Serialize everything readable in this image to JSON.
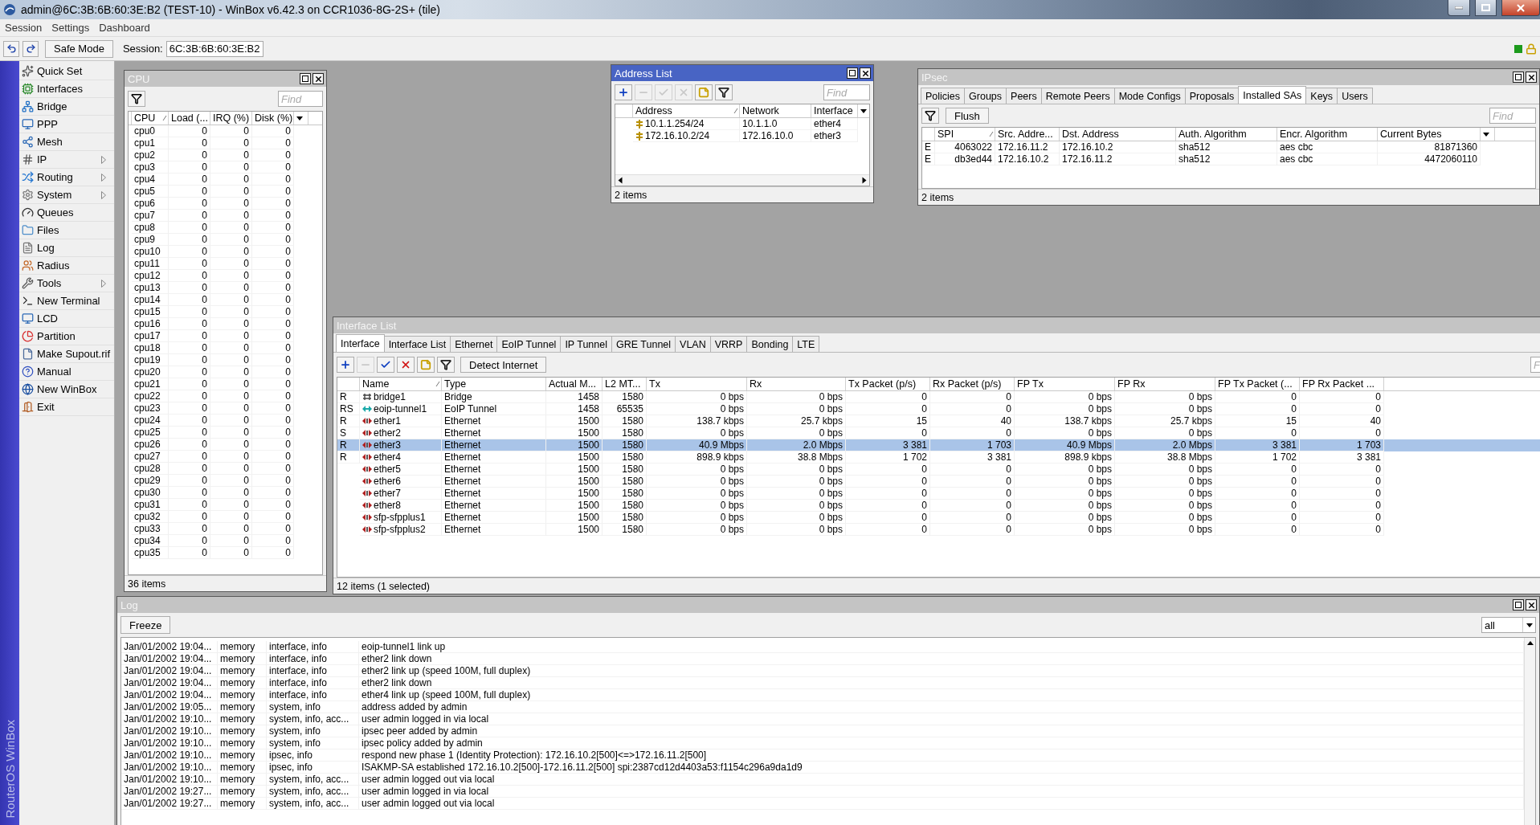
{
  "app_title": "admin@6C:3B:6B:60:3E:B2 (TEST-10) - WinBox v6.42.3 on CCR1036-8G-2S+ (tile)",
  "menu": [
    "Session",
    "Settings",
    "Dashboard"
  ],
  "toolbar": {
    "safe_mode": "Safe Mode",
    "session_label": "Session:",
    "session_value": "6C:3B:6B:60:3E:B2"
  },
  "side_strip": "RouterOS WinBox",
  "sidebar": [
    {
      "label": "Quick Set",
      "submenu": false
    },
    {
      "label": "Interfaces",
      "submenu": false
    },
    {
      "label": "Bridge",
      "submenu": false
    },
    {
      "label": "PPP",
      "submenu": false
    },
    {
      "label": "Mesh",
      "submenu": false
    },
    {
      "label": "IP",
      "submenu": true
    },
    {
      "label": "Routing",
      "submenu": true
    },
    {
      "label": "System",
      "submenu": true
    },
    {
      "label": "Queues",
      "submenu": false
    },
    {
      "label": "Files",
      "submenu": false
    },
    {
      "label": "Log",
      "submenu": false
    },
    {
      "label": "Radius",
      "submenu": false
    },
    {
      "label": "Tools",
      "submenu": true
    },
    {
      "label": "New Terminal",
      "submenu": false
    },
    {
      "label": "LCD",
      "submenu": false
    },
    {
      "label": "Partition",
      "submenu": false
    },
    {
      "label": "Make Supout.rif",
      "submenu": false
    },
    {
      "label": "Manual",
      "submenu": false
    },
    {
      "label": "New WinBox",
      "submenu": false
    },
    {
      "label": "Exit",
      "submenu": false
    }
  ],
  "cpu_window": {
    "title": "CPU",
    "active": false,
    "find_placeholder": "Find",
    "columns": [
      {
        "label": "CPU",
        "sorted": true
      },
      {
        "label": "Load (...",
        "sorted": false
      },
      {
        "label": "IRQ (%)",
        "sorted": false
      },
      {
        "label": "Disk (%)",
        "sorted": false
      }
    ],
    "rows": [
      [
        "cpu0",
        "0",
        "0",
        "0"
      ],
      [
        "cpu1",
        "0",
        "0",
        "0"
      ],
      [
        "cpu2",
        "0",
        "0",
        "0"
      ],
      [
        "cpu3",
        "0",
        "0",
        "0"
      ],
      [
        "cpu4",
        "0",
        "0",
        "0"
      ],
      [
        "cpu5",
        "0",
        "0",
        "0"
      ],
      [
        "cpu6",
        "0",
        "0",
        "0"
      ],
      [
        "cpu7",
        "0",
        "0",
        "0"
      ],
      [
        "cpu8",
        "0",
        "0",
        "0"
      ],
      [
        "cpu9",
        "0",
        "0",
        "0"
      ],
      [
        "cpu10",
        "0",
        "0",
        "0"
      ],
      [
        "cpu11",
        "0",
        "0",
        "0"
      ],
      [
        "cpu12",
        "0",
        "0",
        "0"
      ],
      [
        "cpu13",
        "0",
        "0",
        "0"
      ],
      [
        "cpu14",
        "0",
        "0",
        "0"
      ],
      [
        "cpu15",
        "0",
        "0",
        "0"
      ],
      [
        "cpu16",
        "0",
        "0",
        "0"
      ],
      [
        "cpu17",
        "0",
        "0",
        "0"
      ],
      [
        "cpu18",
        "0",
        "0",
        "0"
      ],
      [
        "cpu19",
        "0",
        "0",
        "0"
      ],
      [
        "cpu20",
        "0",
        "0",
        "0"
      ],
      [
        "cpu21",
        "0",
        "0",
        "0"
      ],
      [
        "cpu22",
        "0",
        "0",
        "0"
      ],
      [
        "cpu23",
        "0",
        "0",
        "0"
      ],
      [
        "cpu24",
        "0",
        "0",
        "0"
      ],
      [
        "cpu25",
        "0",
        "0",
        "0"
      ],
      [
        "cpu26",
        "0",
        "0",
        "0"
      ],
      [
        "cpu27",
        "0",
        "0",
        "0"
      ],
      [
        "cpu28",
        "0",
        "0",
        "0"
      ],
      [
        "cpu29",
        "0",
        "0",
        "0"
      ],
      [
        "cpu30",
        "0",
        "0",
        "0"
      ],
      [
        "cpu31",
        "0",
        "0",
        "0"
      ],
      [
        "cpu32",
        "0",
        "0",
        "0"
      ],
      [
        "cpu33",
        "0",
        "0",
        "0"
      ],
      [
        "cpu34",
        "0",
        "0",
        "0"
      ],
      [
        "cpu35",
        "0",
        "0",
        "0"
      ]
    ],
    "status": "36 items"
  },
  "address_list": {
    "title": "Address List",
    "active": true,
    "find_placeholder": "Find",
    "toolbar": [
      {
        "kind": "add",
        "disabled": false
      },
      {
        "kind": "remove",
        "disabled": true
      },
      {
        "kind": "enable",
        "disabled": true
      },
      {
        "kind": "disable",
        "disabled": true
      },
      {
        "kind": "comment",
        "disabled": false
      },
      {
        "kind": "filter",
        "disabled": false
      }
    ],
    "columns": [
      {
        "label": "Address",
        "sorted": true
      },
      {
        "label": "Network",
        "sorted": false
      },
      {
        "label": "Interface",
        "sorted": false
      }
    ],
    "rows": [
      [
        "10.1.1.254/24",
        "10.1.1.0",
        "ether4"
      ],
      [
        "172.16.10.2/24",
        "172.16.10.0",
        "ether3"
      ]
    ],
    "status": "2 items"
  },
  "ipsec": {
    "title": "IPsec",
    "active": false,
    "tabs": [
      {
        "label": "Policies",
        "selected": false
      },
      {
        "label": "Groups",
        "selected": false
      },
      {
        "label": "Peers",
        "selected": false
      },
      {
        "label": "Remote Peers",
        "selected": false
      },
      {
        "label": "Mode Configs",
        "selected": false
      },
      {
        "label": "Proposals",
        "selected": false
      },
      {
        "label": "Installed SAs",
        "selected": true
      },
      {
        "label": "Keys",
        "selected": false
      },
      {
        "label": "Users",
        "selected": false
      }
    ],
    "flush": "Flush",
    "find_placeholder": "Find",
    "columns": [
      {
        "label": "SPI",
        "sorted": true
      },
      {
        "label": "Src. Addre...",
        "sorted": false
      },
      {
        "label": "Dst. Address",
        "sorted": false
      },
      {
        "label": "Auth. Algorithm",
        "sorted": false
      },
      {
        "label": "Encr. Algorithm",
        "sorted": false
      },
      {
        "label": "Current Bytes",
        "sorted": false
      }
    ],
    "rows": [
      {
        "flag": "E",
        "cells": [
          "4063022",
          "172.16.11.2",
          "172.16.10.2",
          "sha512",
          "aes cbc",
          "81871360"
        ]
      },
      {
        "flag": "E",
        "cells": [
          "db3ed44",
          "172.16.10.2",
          "172.16.11.2",
          "sha512",
          "aes cbc",
          "4472060110"
        ]
      }
    ],
    "status": "2 items"
  },
  "interface_list": {
    "title": "Interface List",
    "active": false,
    "tabs": [
      {
        "label": "Interface",
        "selected": true
      },
      {
        "label": "Interface List",
        "selected": false
      },
      {
        "label": "Ethernet",
        "selected": false
      },
      {
        "label": "EoIP Tunnel",
        "selected": false
      },
      {
        "label": "IP Tunnel",
        "selected": false
      },
      {
        "label": "GRE Tunnel",
        "selected": false
      },
      {
        "label": "VLAN",
        "selected": false
      },
      {
        "label": "VRRP",
        "selected": false
      },
      {
        "label": "Bonding",
        "selected": false
      },
      {
        "label": "LTE",
        "selected": false
      }
    ],
    "toolbar": [
      {
        "kind": "add",
        "disabled": false
      },
      {
        "kind": "remove",
        "disabled": true
      },
      {
        "kind": "enable",
        "disabled": false
      },
      {
        "kind": "disable",
        "disabled": false
      },
      {
        "kind": "comment",
        "disabled": false
      },
      {
        "kind": "filter",
        "disabled": false
      }
    ],
    "detect": "Detect Internet",
    "find_placeholder": "F",
    "columns": [
      {
        "label": "Name",
        "sorted": true
      },
      {
        "label": "Type",
        "sorted": false
      },
      {
        "label": "Actual M...",
        "sorted": false
      },
      {
        "label": "L2 MT...",
        "sorted": false
      },
      {
        "label": "Tx",
        "sorted": false
      },
      {
        "label": "Rx",
        "sorted": false
      },
      {
        "label": "Tx Packet (p/s)",
        "sorted": false
      },
      {
        "label": "Rx Packet (p/s)",
        "sorted": false
      },
      {
        "label": "FP Tx",
        "sorted": false
      },
      {
        "label": "FP Rx",
        "sorted": false
      },
      {
        "label": "FP Tx Packet (...",
        "sorted": false
      },
      {
        "label": "FP Rx Packet ...",
        "sorted": false
      }
    ],
    "rows": [
      {
        "flag": "R",
        "kind": "bridge",
        "selected": false,
        "cells": [
          "bridge1",
          "Bridge",
          "1458",
          "1580",
          "0 bps",
          "0 bps",
          "0",
          "0",
          "0 bps",
          "0 bps",
          "0",
          "0"
        ]
      },
      {
        "flag": "RS",
        "kind": "tunnel",
        "selected": false,
        "cells": [
          "eoip-tunnel1",
          "EoIP Tunnel",
          "1458",
          "65535",
          "0 bps",
          "0 bps",
          "0",
          "0",
          "0 bps",
          "0 bps",
          "0",
          "0"
        ]
      },
      {
        "flag": "R",
        "kind": "ethernet",
        "selected": false,
        "cells": [
          "ether1",
          "Ethernet",
          "1500",
          "1580",
          "138.7 kbps",
          "25.7 kbps",
          "15",
          "40",
          "138.7 kbps",
          "25.7 kbps",
          "15",
          "40"
        ]
      },
      {
        "flag": "S",
        "kind": "ethernet",
        "selected": false,
        "cells": [
          "ether2",
          "Ethernet",
          "1500",
          "1580",
          "0 bps",
          "0 bps",
          "0",
          "0",
          "0 bps",
          "0 bps",
          "0",
          "0"
        ]
      },
      {
        "flag": "R",
        "kind": "ethernet",
        "selected": true,
        "cells": [
          "ether3",
          "Ethernet",
          "1500",
          "1580",
          "40.9 Mbps",
          "2.0 Mbps",
          "3 381",
          "1 703",
          "40.9 Mbps",
          "2.0 Mbps",
          "3 381",
          "1 703"
        ]
      },
      {
        "flag": "R",
        "kind": "ethernet",
        "selected": false,
        "cells": [
          "ether4",
          "Ethernet",
          "1500",
          "1580",
          "898.9 kbps",
          "38.8 Mbps",
          "1 702",
          "3 381",
          "898.9 kbps",
          "38.8 Mbps",
          "1 702",
          "3 381"
        ]
      },
      {
        "kind": "ethernet",
        "selected": false,
        "cells": [
          "ether5",
          "Ethernet",
          "1500",
          "1580",
          "0 bps",
          "0 bps",
          "0",
          "0",
          "0 bps",
          "0 bps",
          "0",
          "0"
        ]
      },
      {
        "kind": "ethernet",
        "selected": false,
        "cells": [
          "ether6",
          "Ethernet",
          "1500",
          "1580",
          "0 bps",
          "0 bps",
          "0",
          "0",
          "0 bps",
          "0 bps",
          "0",
          "0"
        ]
      },
      {
        "kind": "ethernet",
        "selected": false,
        "cells": [
          "ether7",
          "Ethernet",
          "1500",
          "1580",
          "0 bps",
          "0 bps",
          "0",
          "0",
          "0 bps",
          "0 bps",
          "0",
          "0"
        ]
      },
      {
        "kind": "ethernet",
        "selected": false,
        "cells": [
          "ether8",
          "Ethernet",
          "1500",
          "1580",
          "0 bps",
          "0 bps",
          "0",
          "0",
          "0 bps",
          "0 bps",
          "0",
          "0"
        ]
      },
      {
        "kind": "ethernet",
        "selected": false,
        "cells": [
          "sfp-sfpplus1",
          "Ethernet",
          "1500",
          "1580",
          "0 bps",
          "0 bps",
          "0",
          "0",
          "0 bps",
          "0 bps",
          "0",
          "0"
        ]
      },
      {
        "kind": "ethernet",
        "selected": false,
        "cells": [
          "sfp-sfpplus2",
          "Ethernet",
          "1500",
          "1580",
          "0 bps",
          "0 bps",
          "0",
          "0",
          "0 bps",
          "0 bps",
          "0",
          "0"
        ]
      }
    ],
    "status": "12 items (1 selected)"
  },
  "log": {
    "title": "Log",
    "active": false,
    "freeze": "Freeze",
    "filter_value": "all",
    "rows": [
      [
        "Jan/01/2002 19:04...",
        "memory",
        "interface, info",
        "eoip-tunnel1 link up"
      ],
      [
        "Jan/01/2002 19:04...",
        "memory",
        "interface, info",
        "ether2 link down"
      ],
      [
        "Jan/01/2002 19:04...",
        "memory",
        "interface, info",
        "ether2 link up (speed 100M, full duplex)"
      ],
      [
        "Jan/01/2002 19:04...",
        "memory",
        "interface, info",
        "ether2 link down"
      ],
      [
        "Jan/01/2002 19:04...",
        "memory",
        "interface, info",
        "ether4 link up (speed 100M, full duplex)"
      ],
      [
        "Jan/01/2002 19:05...",
        "memory",
        "system, info",
        "address added by admin"
      ],
      [
        "Jan/01/2002 19:10...",
        "memory",
        "system, info, acc...",
        "user admin logged in via local"
      ],
      [
        "Jan/01/2002 19:10...",
        "memory",
        "system, info",
        "ipsec peer added by admin"
      ],
      [
        "Jan/01/2002 19:10...",
        "memory",
        "system, info",
        "ipsec policy added by admin"
      ],
      [
        "Jan/01/2002 19:10...",
        "memory",
        "ipsec, info",
        "respond new phase 1 (Identity Protection): 172.16.10.2[500]<=>172.16.11.2[500]"
      ],
      [
        "Jan/01/2002 19:10...",
        "memory",
        "ipsec, info",
        "ISAKMP-SA established 172.16.10.2[500]-172.16.11.2[500] spi:2387cd12d4403a53:f1154c296a9da1d9"
      ],
      [
        "Jan/01/2002 19:10...",
        "memory",
        "system, info, acc...",
        "user admin logged out via local"
      ],
      [
        "Jan/01/2002 19:27...",
        "memory",
        "system, info, acc...",
        "user admin logged in via local"
      ],
      [
        "Jan/01/2002 19:27...",
        "memory",
        "system, info, acc...",
        "user admin logged out via local"
      ]
    ]
  }
}
